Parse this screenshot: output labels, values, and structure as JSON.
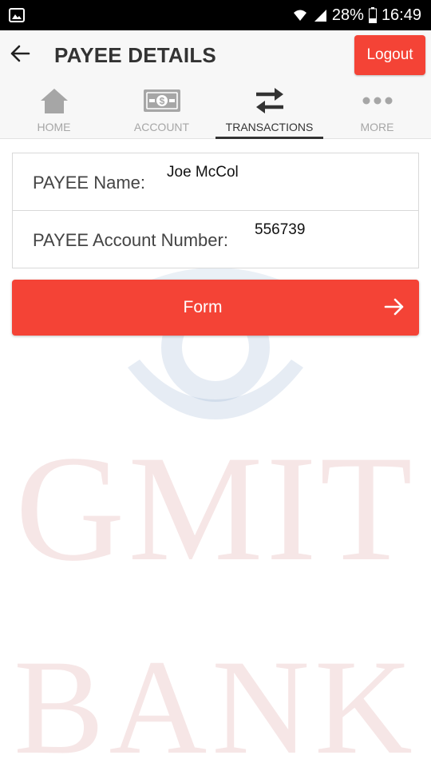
{
  "status_bar": {
    "battery": "28%",
    "time": "16:49"
  },
  "header": {
    "title": "PAYEE DETAILS",
    "logout_label": "Logout"
  },
  "tabs": [
    {
      "label": "HOME",
      "icon": "home-icon",
      "active": false
    },
    {
      "label": "ACCOUNT",
      "icon": "cash-icon",
      "active": false
    },
    {
      "label": "TRANSACTIONS",
      "icon": "transfer-arrows-icon",
      "active": true
    },
    {
      "label": "MORE",
      "icon": "more-dots-icon",
      "active": false
    }
  ],
  "payee": {
    "name_label": "PAYEE Name:",
    "name_value": "Joe McCol",
    "account_label": "PAYEE Account Number:",
    "account_value": "556739"
  },
  "form_button": {
    "label": "Form"
  },
  "watermark": {
    "line1": "GMIT",
    "line2": "BANK"
  },
  "colors": {
    "accent": "#f44336",
    "header_bg": "#f7f7f7",
    "inactive_tab": "#a6a6a6",
    "active_tab": "#333333"
  }
}
